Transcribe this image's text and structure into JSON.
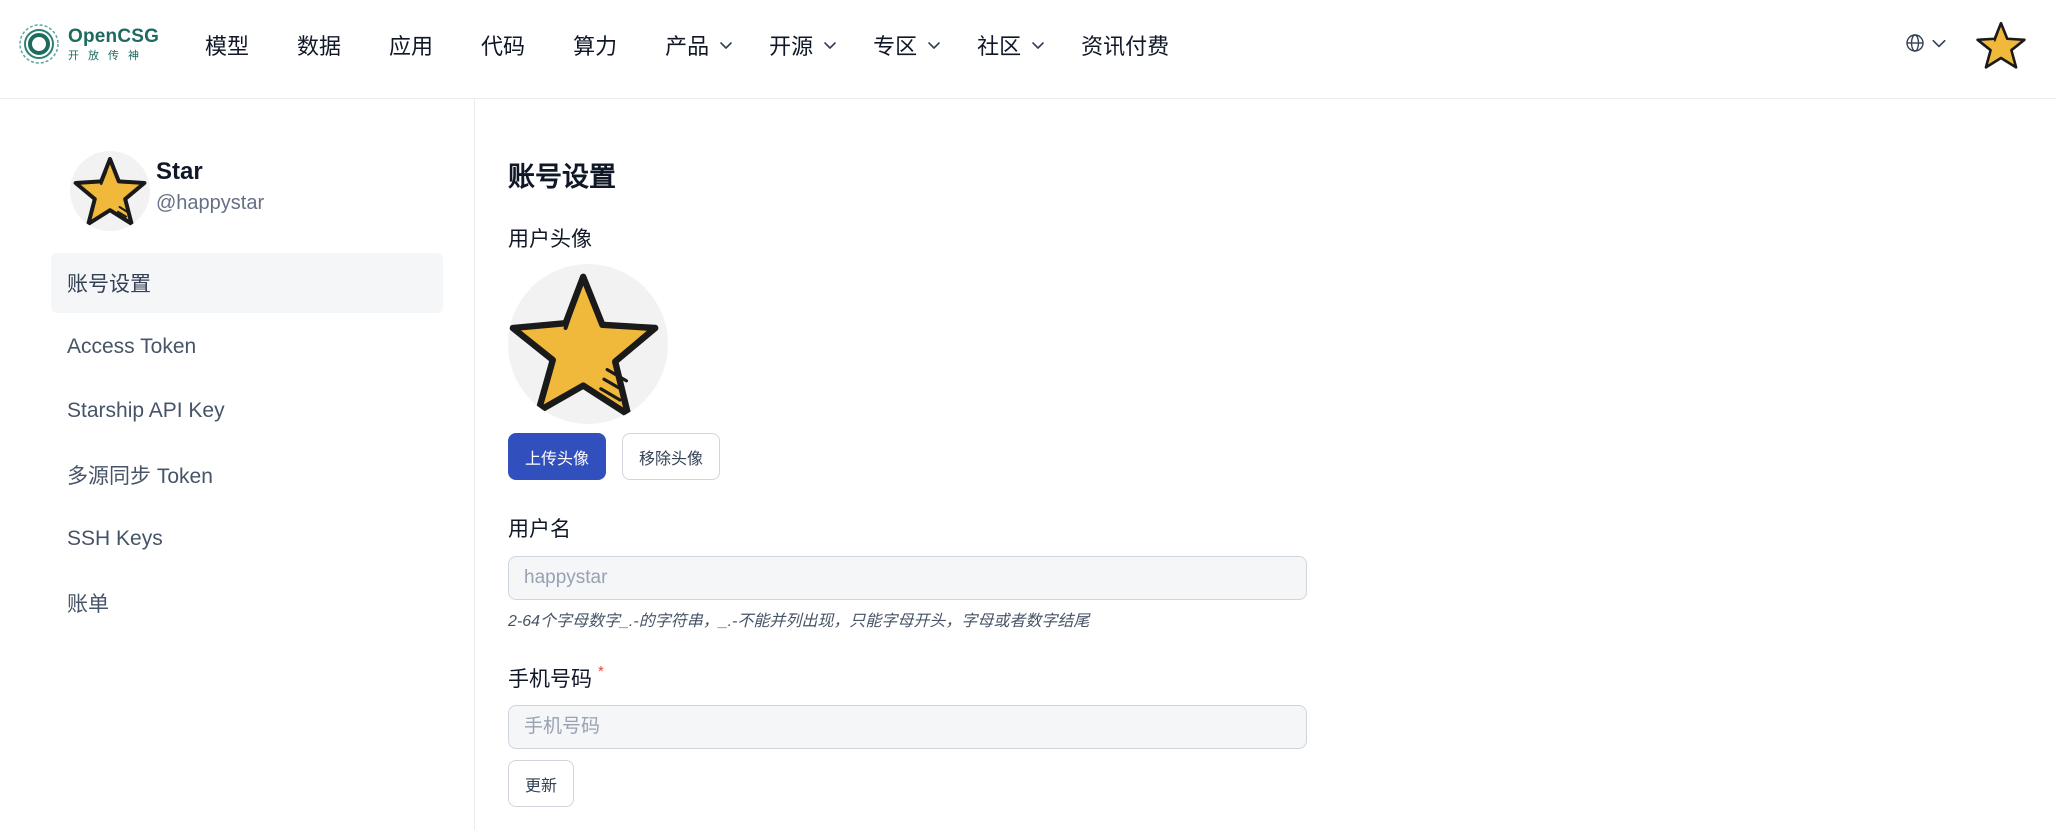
{
  "header": {
    "logo": {
      "title": "OpenCSG",
      "subtitle": "开放传神"
    },
    "nav": [
      {
        "label": "模型",
        "dropdown": false
      },
      {
        "label": "数据",
        "dropdown": false
      },
      {
        "label": "应用",
        "dropdown": false
      },
      {
        "label": "代码",
        "dropdown": false
      },
      {
        "label": "算力",
        "dropdown": false
      },
      {
        "label": "产品",
        "dropdown": true
      },
      {
        "label": "开源",
        "dropdown": true
      },
      {
        "label": "专区",
        "dropdown": true
      },
      {
        "label": "社区",
        "dropdown": true
      },
      {
        "label": "资讯付费",
        "dropdown": false
      }
    ],
    "language_icon": "globe-icon"
  },
  "profile": {
    "name": "Star",
    "handle": "@happystar"
  },
  "sidebar": {
    "items": [
      {
        "label": "账号设置",
        "active": true
      },
      {
        "label": "Access Token",
        "active": false
      },
      {
        "label": "Starship API Key",
        "active": false
      },
      {
        "label": "多源同步 Token",
        "active": false
      },
      {
        "label": "SSH Keys",
        "active": false
      },
      {
        "label": "账单",
        "active": false
      }
    ]
  },
  "main": {
    "title": "账号设置",
    "avatar_section": {
      "label": "用户头像",
      "upload_button": "上传头像",
      "remove_button": "移除头像"
    },
    "username": {
      "label": "用户名",
      "placeholder": "happystar",
      "hint": "2-64个字母数字_.-的字符串，_.-不能并列出现，只能字母开头，字母或者数字结尾"
    },
    "phone": {
      "label": "手机号码",
      "required_mark": "*",
      "placeholder": "手机号码"
    },
    "update_button": "更新"
  },
  "colors": {
    "brand_green": "#1d6b5f",
    "primary_button": "#3250bd",
    "star_fill": "#f0b93b",
    "required": "#f04438"
  }
}
